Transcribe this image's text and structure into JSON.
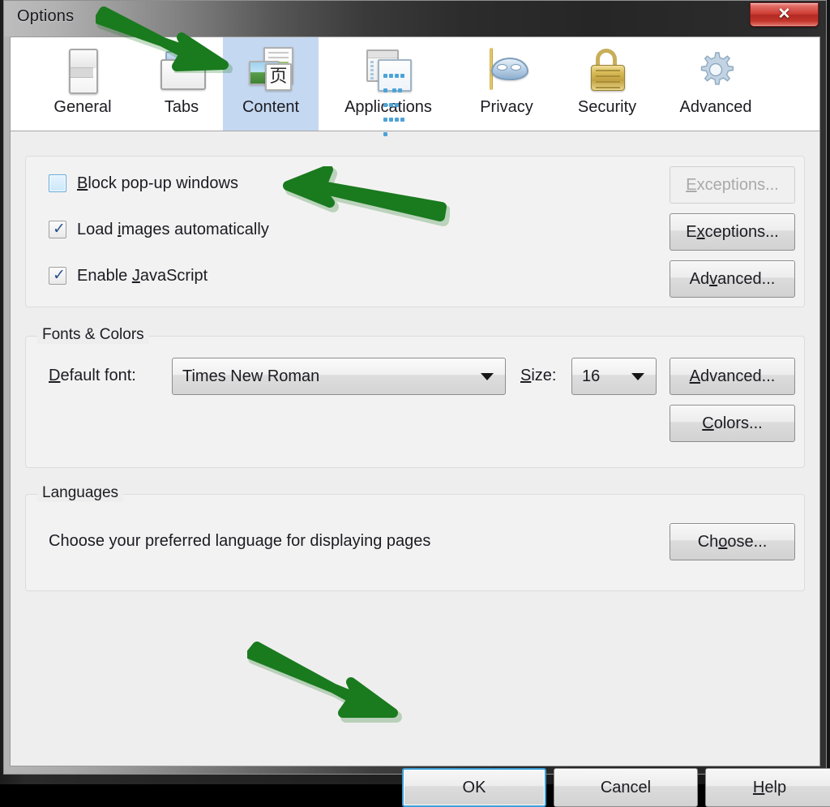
{
  "window": {
    "title": "Options",
    "close_label": "✕"
  },
  "tabs": [
    {
      "label": "General",
      "icon": "general-document-icon",
      "selected": false
    },
    {
      "label": "Tabs",
      "icon": "tabs-folder-icon",
      "selected": false
    },
    {
      "label": "Content",
      "icon": "content-page-image-icon",
      "selected": true
    },
    {
      "label": "Applications",
      "icon": "applications-windows-icon",
      "selected": false
    },
    {
      "label": "Privacy",
      "icon": "privacy-mask-icon",
      "selected": false
    },
    {
      "label": "Security",
      "icon": "security-padlock-icon",
      "selected": false
    },
    {
      "label": "Advanced",
      "icon": "advanced-gear-icon",
      "selected": false
    }
  ],
  "content_panel": {
    "checkboxes": [
      {
        "label_prefix": "",
        "accel": "B",
        "label_rest": "lock pop-up windows",
        "checked": false,
        "highlighted": true
      },
      {
        "label_prefix": "Load ",
        "accel": "i",
        "label_rest": "mages automatically",
        "checked": true,
        "highlighted": false
      },
      {
        "label_prefix": "Enable ",
        "accel": "J",
        "label_rest": "avaScript",
        "checked": true,
        "highlighted": false
      }
    ],
    "checkbox_buttons": [
      {
        "label": "Exceptions...",
        "accel": "E",
        "pre": "",
        "post": "xceptions...",
        "disabled": true
      },
      {
        "label": "Exceptions...",
        "accel": "x",
        "pre": "E",
        "post": "ceptions...",
        "disabled": false
      },
      {
        "label": "Advanced...",
        "accel": "v",
        "pre": "Ad",
        "post": "anced...",
        "disabled": false
      }
    ],
    "fonts_colors": {
      "legend": "Fonts & Colors",
      "default_font_label_pre": "",
      "default_font_accel": "D",
      "default_font_label_post": "efault font:",
      "default_font_value": "Times New Roman",
      "size_label_accel": "S",
      "size_label_post": "ize:",
      "size_value": "16",
      "advanced_button": {
        "pre": "",
        "accel": "A",
        "post": "dvanced..."
      },
      "colors_button": {
        "pre": "",
        "accel": "C",
        "post": "olors..."
      }
    },
    "languages": {
      "legend": "Languages",
      "description": "Choose your preferred language for displaying pages",
      "choose_button": {
        "pre": "Ch",
        "accel": "o",
        "post": "ose..."
      }
    }
  },
  "dialog_buttons": [
    {
      "name": "ok",
      "pre": "OK",
      "accel": "",
      "post": "",
      "default": true
    },
    {
      "name": "cancel",
      "pre": "Cancel",
      "accel": "",
      "post": "",
      "default": false
    },
    {
      "name": "help",
      "pre": "",
      "accel": "H",
      "post": "elp",
      "default": false
    }
  ],
  "annotations": {
    "arrow_color": "#1a7a1e",
    "arrows": [
      {
        "name": "arrow-to-content-tab",
        "points_to": "Content tab"
      },
      {
        "name": "arrow-to-block-popups",
        "points_to": "Block pop-up windows checkbox"
      },
      {
        "name": "arrow-to-ok-button",
        "points_to": "OK button"
      }
    ]
  },
  "colors": {
    "selected_tab_bg": "#c5d8f1",
    "close_button_red": "#cb3b32",
    "focus_blue": "#3c9fd6",
    "panel_bg": "#efeeee"
  }
}
